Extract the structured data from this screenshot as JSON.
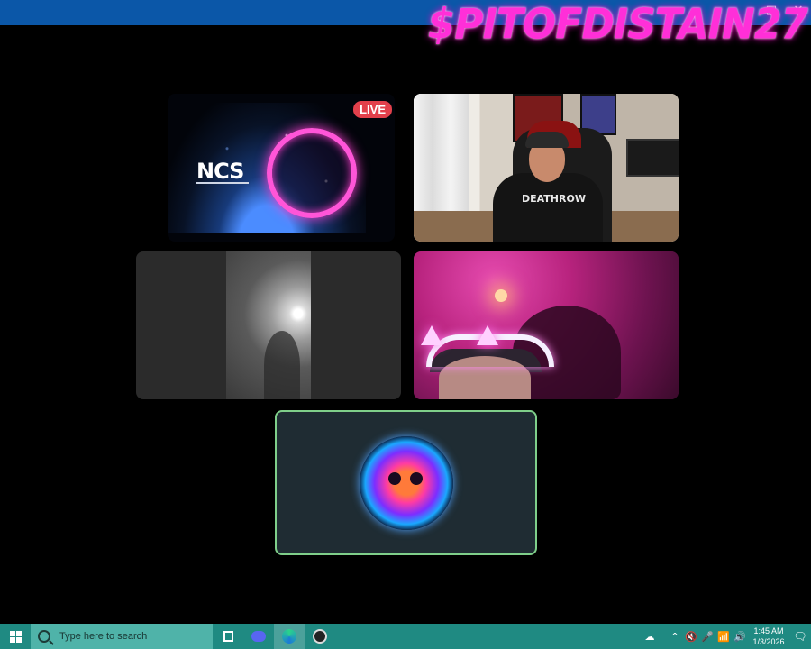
{
  "window": {
    "controls": [
      "□",
      "✕"
    ]
  },
  "overlay": {
    "streamer_name": "$PITOFDISTAIN27"
  },
  "tiles": [
    {
      "id": "ncs",
      "logo_text": "NCS",
      "badge": "LIVE"
    },
    {
      "id": "cam1",
      "shirt_text": "DEATHROW"
    },
    {
      "id": "grey"
    },
    {
      "id": "cam2"
    },
    {
      "id": "avatar",
      "speaking_border_color": "#7fcf8a"
    }
  ],
  "taskbar": {
    "search_placeholder": "Type here to search",
    "apps": [
      {
        "icon": "task-view-icon"
      },
      {
        "icon": "discord-icon"
      },
      {
        "icon": "edge-icon",
        "active": true
      },
      {
        "icon": "obs-icon"
      }
    ],
    "tray": {
      "weather": "☁",
      "chevron": "^",
      "icons": [
        "🔇",
        "🎤",
        "📶",
        "🔊"
      ],
      "time": "1:45 AM",
      "date": "1/3/2026",
      "notifications": "🗨"
    }
  },
  "colors": {
    "taskbar": "#1f8a82",
    "titlebar": "#0b57a8",
    "overlay_text": "#ff2fd8",
    "live_badge": "#e2404b"
  }
}
